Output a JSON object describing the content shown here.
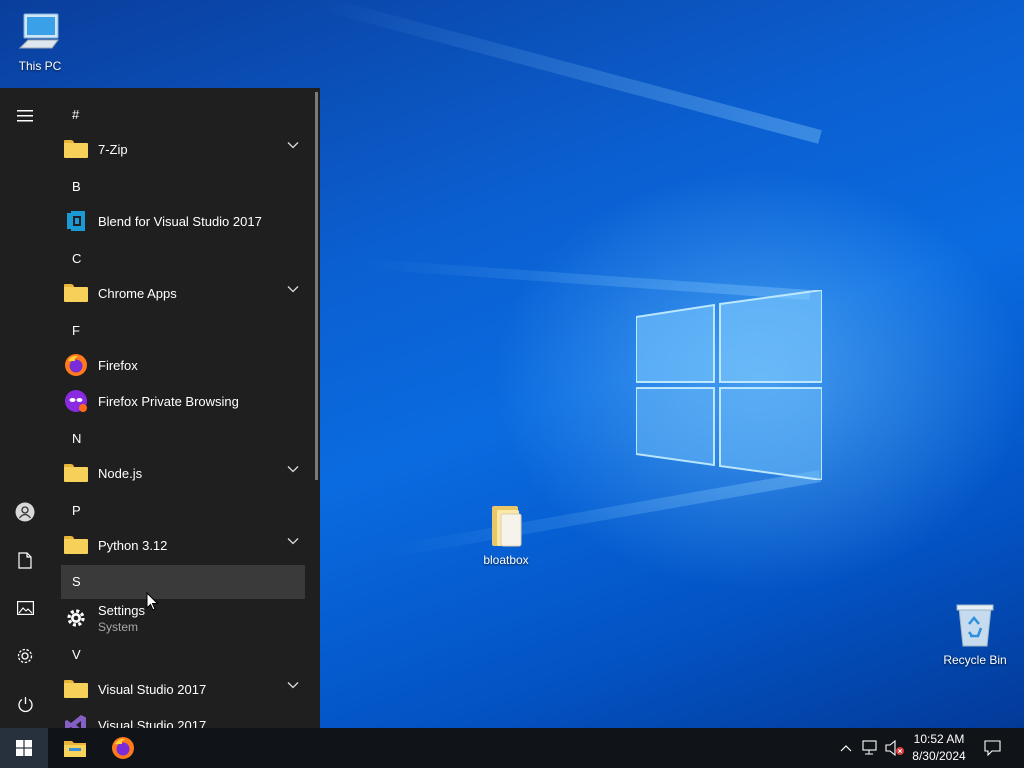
{
  "desktop": {
    "icons": [
      {
        "label": "This PC",
        "icon": "computer-icon"
      },
      {
        "label": "bloatbox",
        "icon": "folder-icon"
      },
      {
        "label": "Recycle Bin",
        "icon": "recycle-bin-icon"
      }
    ]
  },
  "start_menu": {
    "rail": [
      "hamburger-icon",
      "user-icon",
      "documents-icon",
      "pictures-icon",
      "settings-icon",
      "power-icon"
    ],
    "groups": [
      {
        "letter": "#",
        "apps": [
          {
            "name": "7-Zip",
            "icon": "folder-icon",
            "expandable": true
          }
        ]
      },
      {
        "letter": "B",
        "apps": [
          {
            "name": "Blend for Visual Studio 2017",
            "icon": "blend-icon"
          }
        ]
      },
      {
        "letter": "C",
        "apps": [
          {
            "name": "Chrome Apps",
            "icon": "folder-icon",
            "expandable": true
          }
        ]
      },
      {
        "letter": "F",
        "apps": [
          {
            "name": "Firefox",
            "icon": "firefox-icon"
          },
          {
            "name": "Firefox Private Browsing",
            "icon": "firefox-private-icon"
          }
        ]
      },
      {
        "letter": "N",
        "apps": [
          {
            "name": "Node.js",
            "icon": "folder-icon",
            "expandable": true
          }
        ]
      },
      {
        "letter": "P",
        "apps": [
          {
            "name": "Python 3.12",
            "icon": "folder-icon",
            "expandable": true
          }
        ]
      },
      {
        "letter": "S",
        "apps": [
          {
            "name": "Settings",
            "subtitle": "System",
            "icon": "gear-icon"
          }
        ]
      },
      {
        "letter": "V",
        "apps": [
          {
            "name": "Visual Studio 2017",
            "icon": "folder-icon",
            "expandable": true
          },
          {
            "name": "Visual Studio 2017",
            "icon": "visual-studio-icon"
          }
        ]
      }
    ]
  },
  "taskbar": {
    "pinned": [
      "windows-start-icon",
      "file-explorer-icon",
      "firefox-icon"
    ],
    "tray": [
      "chevron-up-icon",
      "network-icon",
      "volume-muted-icon"
    ],
    "time": "10:52 AM",
    "date": "8/30/2024",
    "notification_icon": "action-center-icon"
  },
  "colors": {
    "accent": "#0a6be0",
    "menu_bg": "#1f1f1f",
    "taskbar_bg": "#101318",
    "folder": "#f7d05a"
  }
}
